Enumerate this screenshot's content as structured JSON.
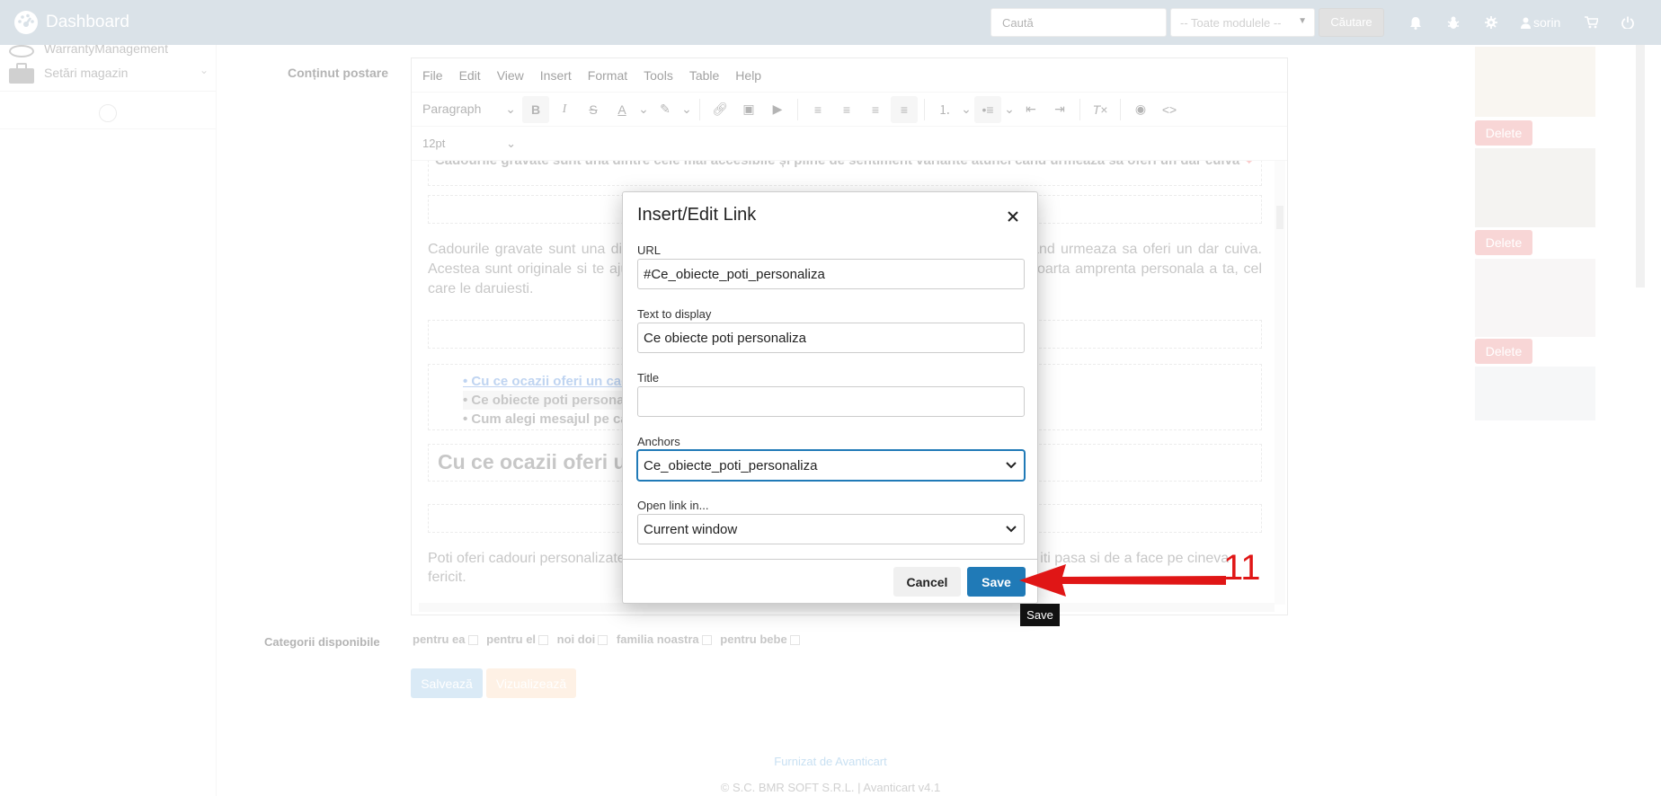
{
  "topbar": {
    "title": "Dashboard",
    "search_placeholder": "Caută",
    "module_select": "-- Toate modulele --",
    "search_button": "Căutare",
    "username": "sorin"
  },
  "sidebar": {
    "items": [
      {
        "label": "WarrantyManagement"
      },
      {
        "label": "Setări magazin"
      }
    ]
  },
  "form": {
    "content_label": "Conținut postare",
    "categories_label": "Categorii disponibile",
    "categories": [
      "pentru ea",
      "pentru el",
      "noi doi",
      "familia noastra",
      "pentru bebe"
    ],
    "save_button": "Salvează",
    "preview_button": "Vizualizează"
  },
  "editor": {
    "menu": [
      "File",
      "Edit",
      "View",
      "Insert",
      "Format",
      "Tools",
      "Table",
      "Help"
    ],
    "block_format": "Paragraph",
    "font_size": "12pt",
    "content": {
      "top_line": "Cadourile gravate sunt una dintre cele mai accesibile și pline de sentiment variante atunci cand urmeaza sa oferi un dar cuiva",
      "top_line_end": "cuiva",
      "heart": "❤",
      "para1": "Cadourile gravate sunt una dintre cele mai accesibile si pline de sentiment variante atunci cand urmeaza sa oferi un dar cuiva. Acestea sunt originale si te ajuta sa creezi un cadou unic si personal. Si, cel mai important, poarta amprenta personala a ta, cel care le daruiesti.",
      "list": [
        "Cu ce ocazii oferi un cadou personalizat",
        "Ce obiecte poti personaliza",
        "Cum alegi mesajul pe care sa il gravezi"
      ],
      "heading": "Cu ce ocazii oferi un cadou personalizat",
      "para2": "Poti oferi cadouri personalizate la orice ocazie, fiindca este o modalitate frumoasa de a arata ca iti pasa si de a face pe cineva fericit."
    }
  },
  "dialog": {
    "title": "Insert/Edit Link",
    "url_label": "URL",
    "url_value": "#Ce_obiecte_poti_personaliza",
    "text_label": "Text to display",
    "text_value": "Ce obiecte poti personaliza",
    "title_label": "Title",
    "title_value": "",
    "anchors_label": "Anchors",
    "anchors_value": "Ce_obiecte_poti_personaliza",
    "target_label": "Open link in...",
    "target_value": "Current window",
    "cancel": "Cancel",
    "save": "Save"
  },
  "tooltip": "Save",
  "annotation": {
    "step_number": "11",
    "color": "#e01616"
  },
  "images": {
    "delete_label": "Delete"
  },
  "footer": {
    "powered": "Furnizat de Avanticart",
    "copyright": "© S.C. BMR SOFT S.R.L. | Avanticart v4.1"
  },
  "colors": {
    "topbar": "#bccad6",
    "primary": "#207ab7",
    "delete": "#f3b5b5"
  }
}
